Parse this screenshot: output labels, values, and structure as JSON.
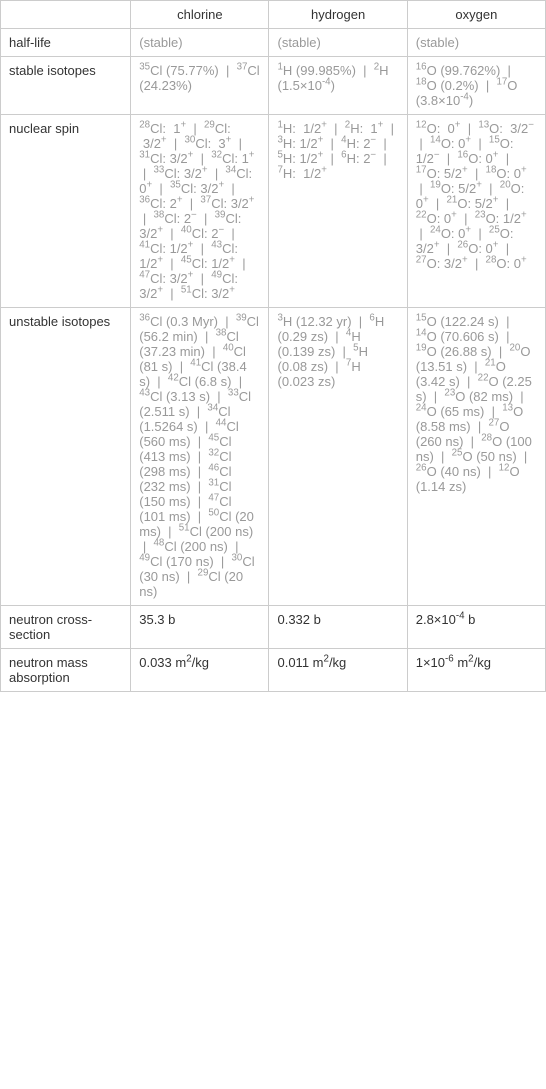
{
  "headers": {
    "blank": "",
    "col1": "chlorine",
    "col2": "hydrogen",
    "col3": "oxygen"
  },
  "rows": {
    "halflife": {
      "label": "half-life",
      "col1": "(stable)",
      "col2": "(stable)",
      "col3": "(stable)"
    },
    "stable": {
      "label": "stable isotopes",
      "col1": "<sup>35</sup>Cl (75.77%) &nbsp;|&nbsp; <sup>37</sup>Cl (24.23%)",
      "col2": "<sup>1</sup>H (99.985%) &nbsp;|&nbsp; <sup>2</sup>H (1.5×10<sup>-4</sup>)",
      "col3": "<sup>16</sup>O (99.762%) &nbsp;|&nbsp; <sup>18</sup>O (0.2%) &nbsp;|&nbsp; <sup>17</sup>O (3.8×10<sup>-4</sup>)"
    },
    "spin": {
      "label": "nuclear spin",
      "col1": "<sup>28</sup>Cl: &nbsp;1<sup>+</sup> &nbsp;|&nbsp; <sup>29</sup>Cl: &nbsp;3/2<sup>+</sup> &nbsp;|&nbsp; <sup>30</sup>Cl: &nbsp;3<sup>+</sup> &nbsp;|&nbsp; <sup>31</sup>Cl: 3/2<sup>+</sup> &nbsp;|&nbsp; <sup>32</sup>Cl: 1<sup>+</sup> &nbsp;|&nbsp; <sup>33</sup>Cl: 3/2<sup>+</sup> &nbsp;|&nbsp; <sup>34</sup>Cl: 0<sup>+</sup> &nbsp;|&nbsp; <sup>35</sup>Cl: 3/2<sup>+</sup> &nbsp;|&nbsp; <sup>36</sup>Cl: 2<sup>+</sup> &nbsp;|&nbsp; <sup>37</sup>Cl: 3/2<sup>+</sup> &nbsp;|&nbsp; <sup>38</sup>Cl: 2<sup>−</sup> &nbsp;|&nbsp; <sup>39</sup>Cl: 3/2<sup>+</sup> &nbsp;|&nbsp; <sup>40</sup>Cl: 2<sup>−</sup> &nbsp;|&nbsp; <sup>41</sup>Cl: 1/2<sup>+</sup> &nbsp;|&nbsp; <sup>43</sup>Cl: 1/2<sup>+</sup> &nbsp;|&nbsp; <sup>45</sup>Cl: 1/2<sup>+</sup> &nbsp;|&nbsp; <sup>47</sup>Cl: 3/2<sup>+</sup> &nbsp;|&nbsp; <sup>49</sup>Cl: 3/2<sup>+</sup> &nbsp;|&nbsp; <sup>51</sup>Cl: 3/2<sup>+</sup>",
      "col2": "<sup>1</sup>H: &nbsp;1/2<sup>+</sup> &nbsp;|&nbsp; <sup>2</sup>H: &nbsp;1<sup>+</sup> &nbsp;|&nbsp; <sup>3</sup>H: 1/2<sup>+</sup> &nbsp;|&nbsp; <sup>4</sup>H: 2<sup>−</sup> &nbsp;|&nbsp; <sup>5</sup>H: 1/2<sup>+</sup> &nbsp;|&nbsp; <sup>6</sup>H: 2<sup>−</sup> &nbsp;|&nbsp; <sup>7</sup>H: &nbsp;1/2<sup>+</sup>",
      "col3": "<sup>12</sup>O: &nbsp;0<sup>+</sup> &nbsp;|&nbsp; <sup>13</sup>O: &nbsp;3/2<sup>−</sup> &nbsp;|&nbsp; <sup>14</sup>O: 0<sup>+</sup> &nbsp;|&nbsp; <sup>15</sup>O: 1/2<sup>−</sup> &nbsp;|&nbsp; <sup>16</sup>O: 0<sup>+</sup> &nbsp;|&nbsp; <sup>17</sup>O: 5/2<sup>+</sup> &nbsp;|&nbsp; <sup>18</sup>O: 0<sup>+</sup> &nbsp;|&nbsp; <sup>19</sup>O: 5/2<sup>+</sup> &nbsp;|&nbsp; <sup>20</sup>O: 0<sup>+</sup> &nbsp;|&nbsp; <sup>21</sup>O: 5/2<sup>+</sup> &nbsp;|&nbsp; <sup>22</sup>O: 0<sup>+</sup> &nbsp;|&nbsp; <sup>23</sup>O: 1/2<sup>+</sup> &nbsp;|&nbsp; <sup>24</sup>O: 0<sup>+</sup> &nbsp;|&nbsp; <sup>25</sup>O: 3/2<sup>+</sup> &nbsp;|&nbsp; <sup>26</sup>O: 0<sup>+</sup> &nbsp;|&nbsp; <sup>27</sup>O: 3/2<sup>+</sup> &nbsp;|&nbsp; <sup>28</sup>O: 0<sup>+</sup>"
    },
    "unstable": {
      "label": "unstable isotopes",
      "col1": "<sup>36</sup>Cl (0.3 Myr) &nbsp;|&nbsp; <sup>39</sup>Cl (56.2 min) &nbsp;|&nbsp; <sup>38</sup>Cl (37.23 min) &nbsp;|&nbsp; <sup>40</sup>Cl (81 s) &nbsp;|&nbsp; <sup>41</sup>Cl (38.4 s) &nbsp;|&nbsp; <sup>42</sup>Cl (6.8 s) &nbsp;|&nbsp; <sup>43</sup>Cl (3.13 s) &nbsp;|&nbsp; <sup>33</sup>Cl (2.511 s) &nbsp;|&nbsp; <sup>34</sup>Cl (1.5264 s) &nbsp;|&nbsp; <sup>44</sup>Cl (560 ms) &nbsp;|&nbsp; <sup>45</sup>Cl (413 ms) &nbsp;|&nbsp; <sup>32</sup>Cl (298 ms) &nbsp;|&nbsp; <sup>46</sup>Cl (232 ms) &nbsp;|&nbsp; <sup>31</sup>Cl (150 ms) &nbsp;|&nbsp; <sup>47</sup>Cl (101 ms) &nbsp;|&nbsp; <sup>50</sup>Cl (20 ms) &nbsp;|&nbsp; <sup>51</sup>Cl (200 ns) &nbsp;|&nbsp; <sup>48</sup>Cl (200 ns) &nbsp;|&nbsp; <sup>49</sup>Cl (170 ns) &nbsp;|&nbsp; <sup>30</sup>Cl (30 ns) &nbsp;|&nbsp; <sup>29</sup>Cl (20 ns)",
      "col2": "<sup>3</sup>H (12.32 yr) &nbsp;|&nbsp; <sup>6</sup>H (0.29 zs) &nbsp;|&nbsp; <sup>4</sup>H (0.139 zs) &nbsp;|&nbsp; <sup>5</sup>H (0.08 zs) &nbsp;|&nbsp; <sup>7</sup>H (0.023 zs)",
      "col3": "<sup>15</sup>O (122.24 s) &nbsp;|&nbsp; <sup>14</sup>O (70.606 s) &nbsp;|&nbsp; <sup>19</sup>O (26.88 s) &nbsp;|&nbsp; <sup>20</sup>O (13.51 s) &nbsp;|&nbsp; <sup>21</sup>O (3.42 s) &nbsp;|&nbsp; <sup>22</sup>O (2.25 s) &nbsp;|&nbsp; <sup>23</sup>O (82 ms) &nbsp;|&nbsp; <sup>24</sup>O (65 ms) &nbsp;|&nbsp; <sup>13</sup>O (8.58 ms) &nbsp;|&nbsp; <sup>27</sup>O (260 ns) &nbsp;|&nbsp; <sup>28</sup>O (100 ns) &nbsp;|&nbsp; <sup>25</sup>O (50 ns) &nbsp;|&nbsp; <sup>26</sup>O (40 ns) &nbsp;|&nbsp; <sup>12</sup>O (1.14 zs)"
    },
    "cross": {
      "label": "neutron cross-section",
      "col1": "35.3 b",
      "col2": "0.332 b",
      "col3": "2.8×10<sup>-4</sup> b"
    },
    "mass": {
      "label": "neutron mass absorption",
      "col1": "0.033 m<sup>2</sup>/kg",
      "col2": "0.011 m<sup>2</sup>/kg",
      "col3": "1×10<sup>-6</sup> m<sup>2</sup>/kg"
    }
  }
}
